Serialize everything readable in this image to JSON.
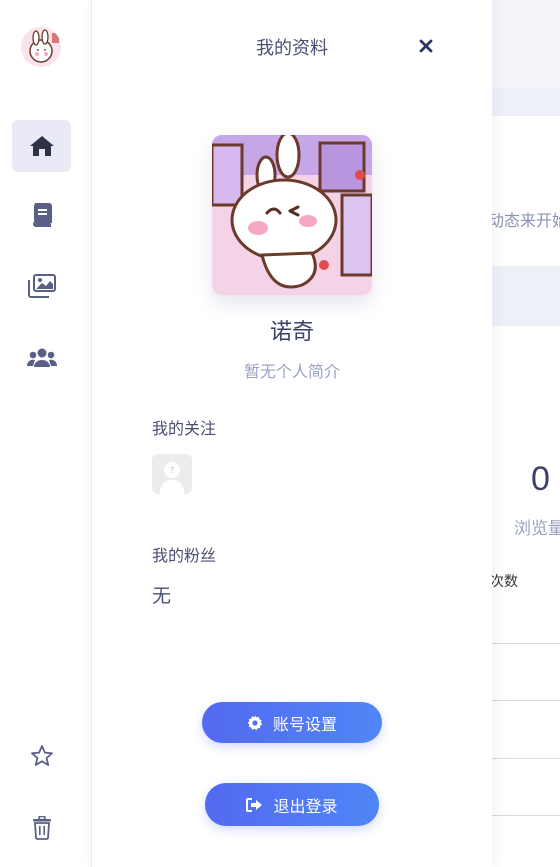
{
  "rail": {
    "avatar_icon": "user-avatar",
    "items": [
      {
        "icon": "home-icon",
        "active": true
      },
      {
        "icon": "book-icon",
        "active": false
      },
      {
        "icon": "images-icon",
        "active": false
      },
      {
        "icon": "users-icon",
        "active": false
      }
    ],
    "bottom_items": [
      {
        "icon": "star-icon"
      },
      {
        "icon": "trash-icon"
      }
    ]
  },
  "background": {
    "dynamic_text": "动态来开始",
    "stat_value": "0",
    "stat_label": "浏览量",
    "times_label": "次数"
  },
  "panel": {
    "title": "我的资料",
    "name": "诺奇",
    "bio": "暂无个人简介",
    "following_label": "我的关注",
    "fans_label": "我的粉丝",
    "fans_value": "无",
    "settings_button": "账号设置",
    "logout_button": "退出登录"
  },
  "colors": {
    "accent": "#5469f0",
    "accent_2": "#4f86f7",
    "rail_icon": "#5a5f86",
    "active_bg": "#e9eaf6"
  }
}
